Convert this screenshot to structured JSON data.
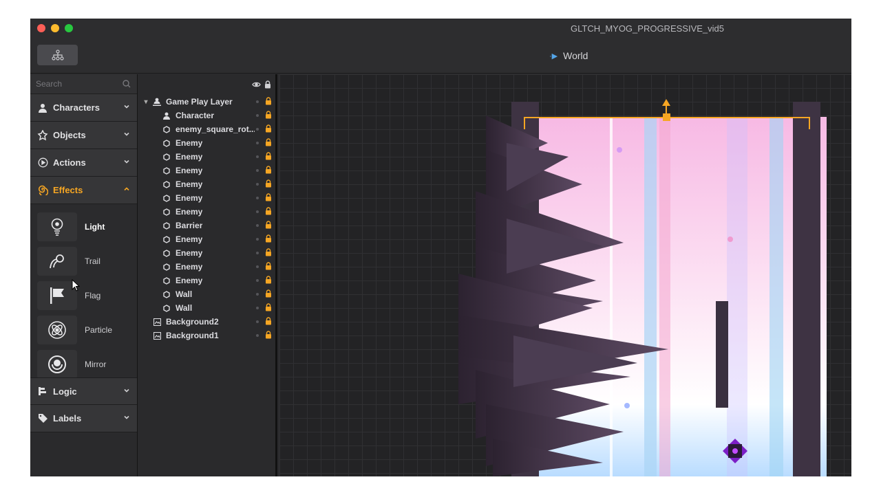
{
  "window": {
    "title": "GLTCH_MYOG_PROGRESSIVE_vid5",
    "traffic_lights": {
      "close": "#fe5f57",
      "minimize": "#febc2e",
      "zoom": "#28c840"
    }
  },
  "toolbar": {
    "hierarchy_button_icon": "hierarchy-icon",
    "breadcrumb": "World"
  },
  "sidebar": {
    "search_placeholder": "Search",
    "categories": [
      {
        "label": "Characters",
        "icon": "person-icon",
        "expanded": false
      },
      {
        "label": "Objects",
        "icon": "puzzle-icon",
        "expanded": false
      },
      {
        "label": "Actions",
        "icon": "play-circle-icon",
        "expanded": false
      },
      {
        "label": "Effects",
        "icon": "swirl-icon",
        "expanded": true
      }
    ],
    "effects": [
      {
        "label": "Light",
        "icon": "light-bulb-icon"
      },
      {
        "label": "Trail",
        "icon": "trail-icon"
      },
      {
        "label": "Flag",
        "icon": "flag-icon"
      },
      {
        "label": "Particle",
        "icon": "atom-icon"
      },
      {
        "label": "Mirror",
        "icon": "mirror-icon"
      }
    ],
    "bottom_categories": [
      {
        "label": "Logic",
        "icon": "logic-icon",
        "expanded": false
      },
      {
        "label": "Labels",
        "icon": "tag-icon",
        "expanded": false
      }
    ],
    "accent_color": "#f6a623"
  },
  "layers": {
    "group": "Game Play Layer",
    "items": [
      {
        "label": "Character",
        "icon": "person-icon"
      },
      {
        "label": "enemy_square_rot...",
        "icon": "hexagon-icon"
      },
      {
        "label": "Enemy",
        "icon": "hexagon-icon"
      },
      {
        "label": "Enemy",
        "icon": "hexagon-icon"
      },
      {
        "label": "Enemy",
        "icon": "hexagon-icon"
      },
      {
        "label": "Enemy",
        "icon": "hexagon-icon"
      },
      {
        "label": "Enemy",
        "icon": "hexagon-icon"
      },
      {
        "label": "Enemy",
        "icon": "hexagon-icon"
      },
      {
        "label": "Barrier",
        "icon": "hexagon-icon"
      },
      {
        "label": "Enemy",
        "icon": "hexagon-icon"
      },
      {
        "label": "Enemy",
        "icon": "hexagon-icon"
      },
      {
        "label": "Enemy",
        "icon": "hexagon-icon"
      },
      {
        "label": "Enemy",
        "icon": "hexagon-icon"
      },
      {
        "label": "Wall",
        "icon": "hexagon-icon"
      },
      {
        "label": "Wall",
        "icon": "hexagon-icon"
      }
    ],
    "backgrounds": [
      {
        "label": "Background2",
        "icon": "image-icon"
      },
      {
        "label": "Background1",
        "icon": "image-icon"
      }
    ],
    "lock_color": "#f6a623"
  }
}
